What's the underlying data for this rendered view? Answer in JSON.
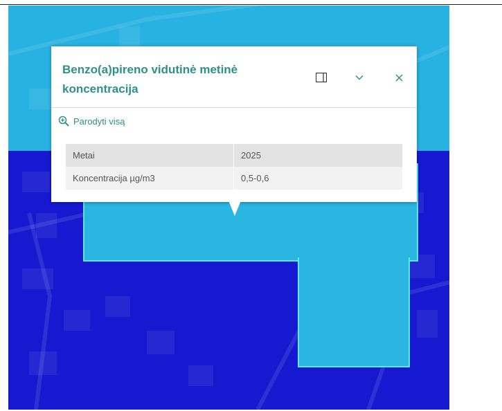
{
  "popup": {
    "title": "Benzo(a)pireno vidutinė metinė koncentracija",
    "dock_icon": "dock-panel-icon",
    "collapse_icon": "chevron-down-icon",
    "close_icon": "close-icon",
    "zoom_to_label": "Parodyti visą",
    "attributes": [
      {
        "label": "Metai",
        "value": "2025"
      },
      {
        "label": "Koncentracija µg/m3",
        "value": "0,5-0,6"
      }
    ]
  },
  "colors": {
    "accent": "#2f8f8b",
    "map_low_zone": "#28b2e1",
    "map_selected_zone": "#2bb6e2",
    "map_selected_outline": "#5fe6ff",
    "map_background_zone": "#1619cf"
  }
}
